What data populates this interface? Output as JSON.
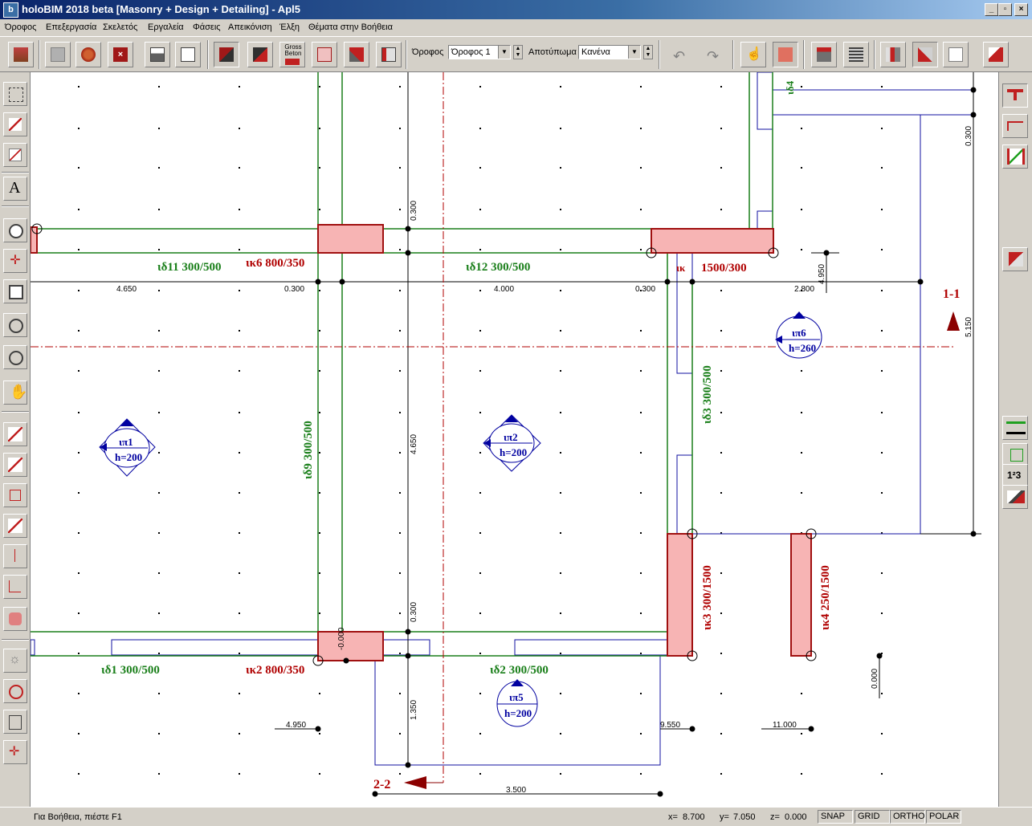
{
  "window": {
    "title": "holoBIM 2018 beta [Masonry + Design + Detailing] - Apl5",
    "app_icon": "b"
  },
  "menu": [
    "Όροφος",
    "Επεξεργασία",
    "Σκελετός",
    "Εργαλεία",
    "Φάσεις",
    "Απεικόνιση",
    "Έλξη",
    "Θέματα στην Βοήθεια"
  ],
  "toolbar": {
    "floor_label": "Όροφος",
    "floor_value": "Όροφος 1",
    "footprint_label": "Αποτύπωμα",
    "footprint_value": "Κανένα",
    "gross_beton_label": "Gross Beton"
  },
  "right_toolbar": {
    "numbering_label": "1²3"
  },
  "drawing": {
    "beams": {
      "b11": "ιδ11  300/500",
      "b12": "ιδ12  300/500",
      "b1": "ιδ1  300/500",
      "b2": "ιδ2  300/500",
      "b9": "ιδ9  300/500",
      "b3": "ιδ3  300/500",
      "b4": "ιδ4"
    },
    "columns": {
      "c6": "ικ6  800/350",
      "c7a": "ικ",
      "c7b": "1500/300",
      "c2": "ικ2  800/350",
      "c3": "ικ3  300/1500",
      "c4": "ικ4  250/1500"
    },
    "slabs": [
      {
        "name": "ιπ1",
        "h": "h=200"
      },
      {
        "name": "ιπ2",
        "h": "h=200"
      },
      {
        "name": "ιπ6",
        "h": "h=260"
      },
      {
        "name": "ιπ5",
        "h": "h=200"
      }
    ],
    "sections": {
      "s1": "1-1",
      "s2": "2-2"
    },
    "dims": {
      "d4650": "4.650",
      "d0300a": "0.300",
      "d4000": "4.000",
      "d0300b": "0.300",
      "d2800": "2.800",
      "v0300top": "0.300",
      "v0300mid": "0.300",
      "v0300right": "0.300",
      "v4650": "4.650",
      "v4950": "4.950",
      "v5150": "5.150",
      "v1350": "1.350",
      "v0000": "0.000",
      "v0000b": "-0.000",
      "e4950": "4.950",
      "e9550": "9.550",
      "e11000": "11.000",
      "d3500": "3.500"
    }
  },
  "status": {
    "help": "Για Βοήθεια, πιέστε F1",
    "x_label": "x=",
    "x": "8.700",
    "y_label": "y=",
    "y": "7.050",
    "z_label": "z=",
    "z": "0.000",
    "snap": "SNAP",
    "grid": "GRID",
    "ortho": "ORTHO",
    "polar": "POLAR"
  }
}
